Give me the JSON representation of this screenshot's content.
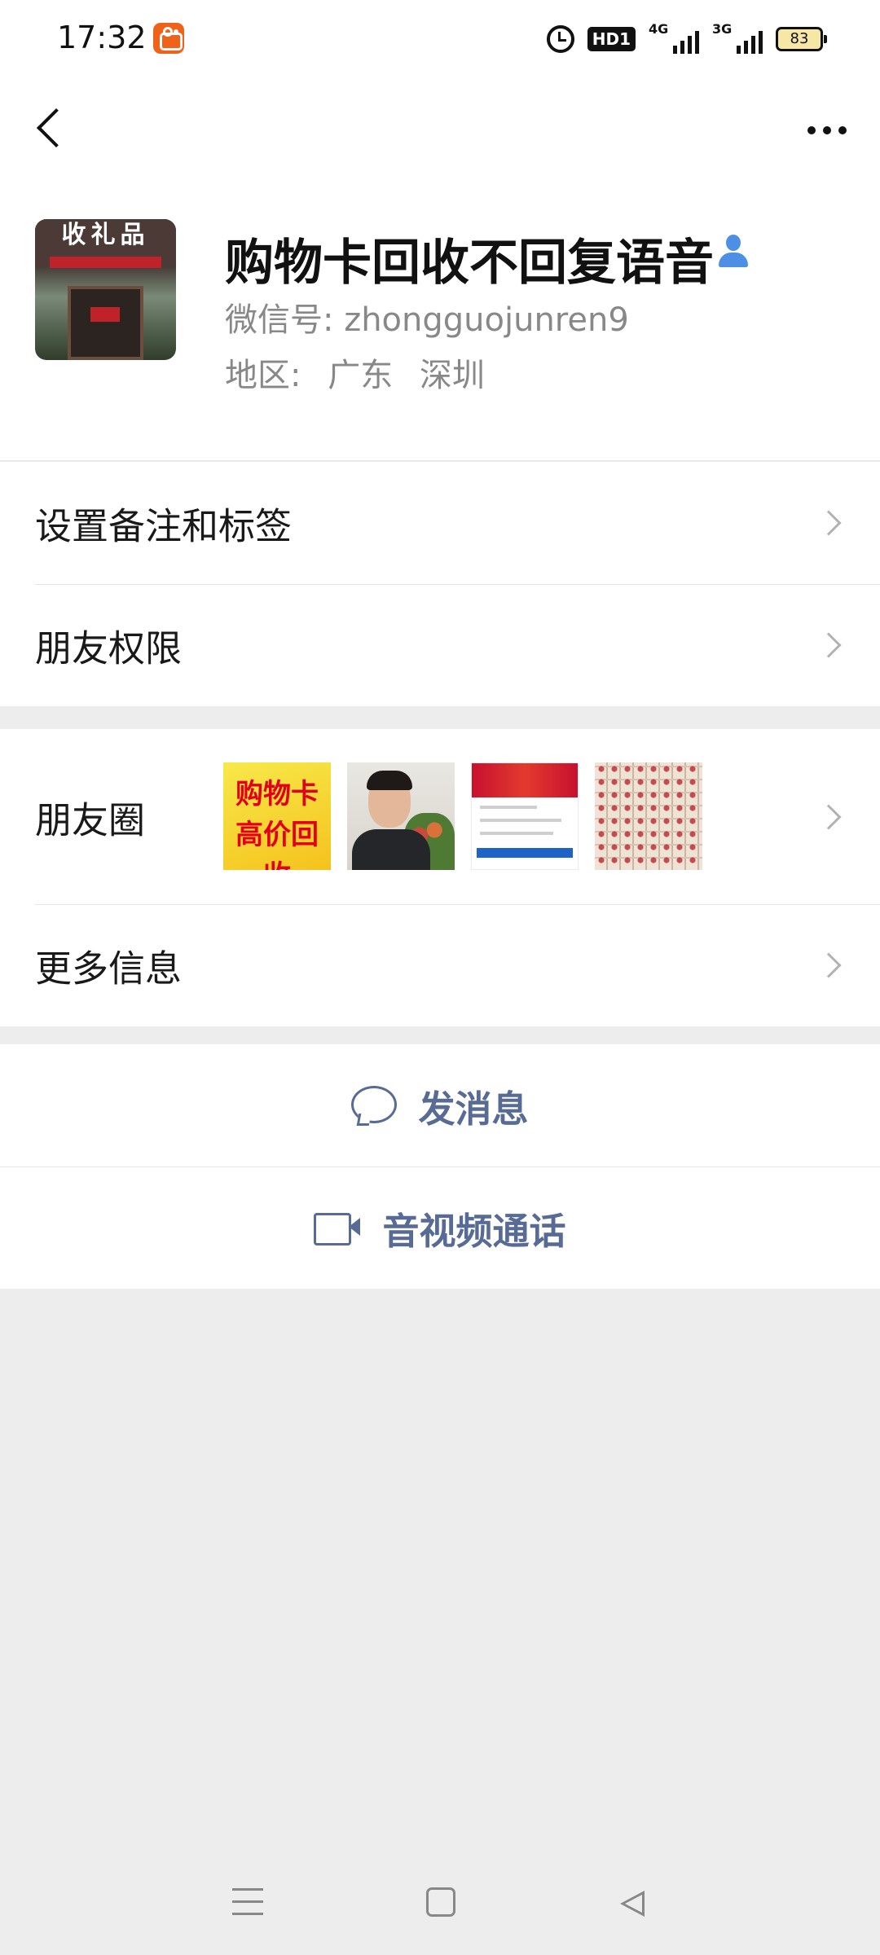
{
  "status_bar": {
    "time": "17:32",
    "hd_label": "HD1",
    "network_1": "4G",
    "network_2": "3G",
    "battery": "83"
  },
  "profile": {
    "name": "购物卡回收不回复语音",
    "wechat_id_label": "微信号:",
    "wechat_id": "zhongguojunren9",
    "region_label": "地区:",
    "region_province": "广东",
    "region_city": "深圳",
    "avatar_sign_text": "收礼品"
  },
  "menu": {
    "remarks_tags": "设置备注和标签",
    "friend_permissions": "朋友权限",
    "moments": "朋友圈",
    "more_info": "更多信息"
  },
  "moments_thumbs": {
    "thumb1_text_line1": "购物卡",
    "thumb1_text_line2": "高价回收"
  },
  "actions": {
    "send_message": "发消息",
    "video_call": "音视频通话"
  },
  "colors": {
    "link_blue": "#576b95",
    "background": "#ededed",
    "verified_icon": "#4e8fe6"
  }
}
